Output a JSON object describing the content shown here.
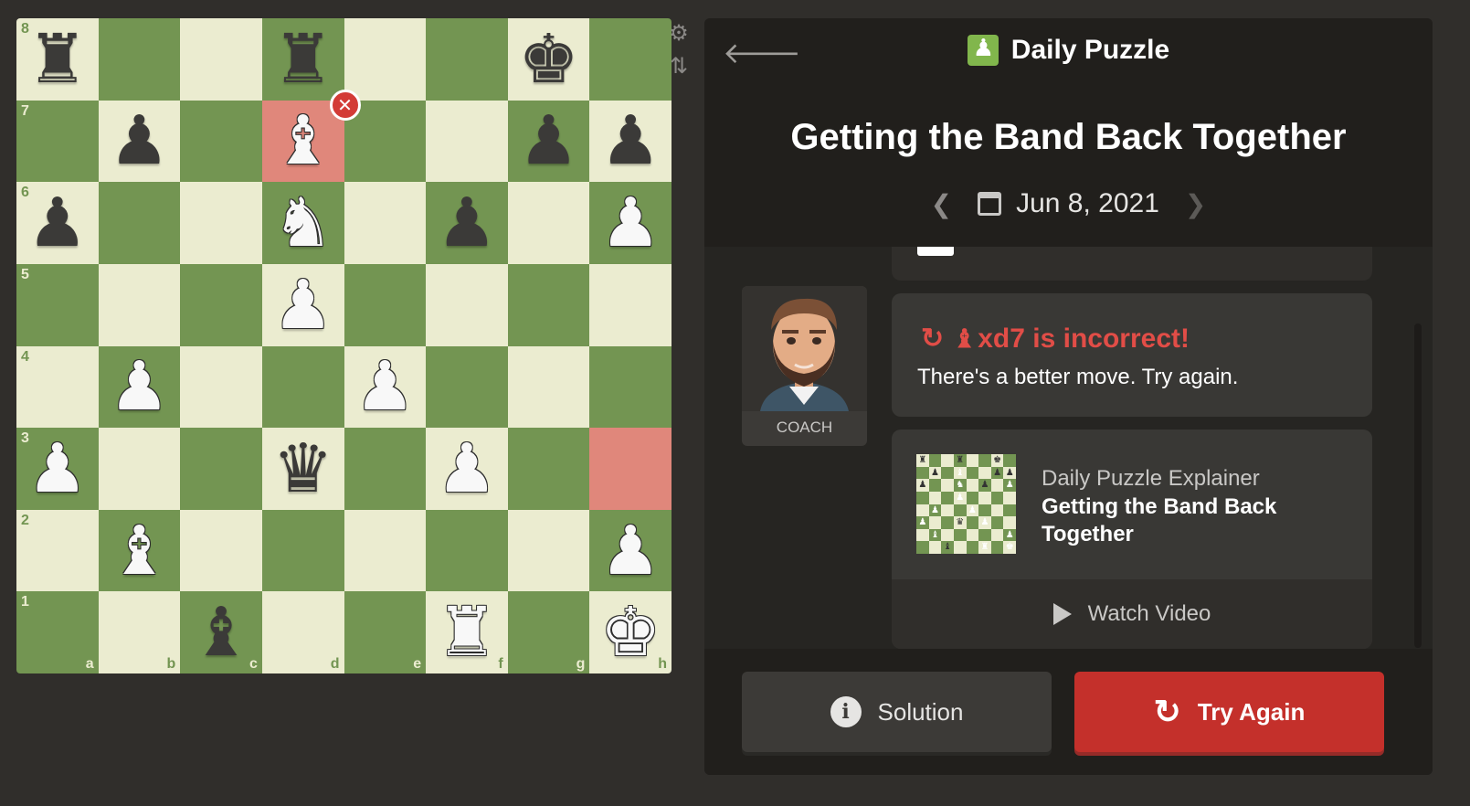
{
  "board": {
    "highlight_squares": [
      "d7",
      "h3"
    ],
    "error_square": "d7",
    "pieces": [
      {
        "sq": "a8",
        "color": "b",
        "type": "rook"
      },
      {
        "sq": "d8",
        "color": "b",
        "type": "rook"
      },
      {
        "sq": "g8",
        "color": "b",
        "type": "king"
      },
      {
        "sq": "b7",
        "color": "b",
        "type": "pawn"
      },
      {
        "sq": "d7",
        "color": "w",
        "type": "bishop"
      },
      {
        "sq": "g7",
        "color": "b",
        "type": "pawn"
      },
      {
        "sq": "h7",
        "color": "b",
        "type": "pawn"
      },
      {
        "sq": "a6",
        "color": "b",
        "type": "pawn"
      },
      {
        "sq": "d6",
        "color": "w",
        "type": "knight"
      },
      {
        "sq": "f6",
        "color": "b",
        "type": "pawn"
      },
      {
        "sq": "h6",
        "color": "w",
        "type": "pawn"
      },
      {
        "sq": "d5",
        "color": "w",
        "type": "pawn"
      },
      {
        "sq": "b4",
        "color": "w",
        "type": "pawn"
      },
      {
        "sq": "e4",
        "color": "w",
        "type": "pawn"
      },
      {
        "sq": "a3",
        "color": "w",
        "type": "pawn"
      },
      {
        "sq": "d3",
        "color": "b",
        "type": "queen"
      },
      {
        "sq": "f3",
        "color": "w",
        "type": "pawn"
      },
      {
        "sq": "b2",
        "color": "w",
        "type": "bishop"
      },
      {
        "sq": "h2",
        "color": "w",
        "type": "pawn"
      },
      {
        "sq": "c1",
        "color": "b",
        "type": "bishop"
      },
      {
        "sq": "f1",
        "color": "w",
        "type": "rook"
      },
      {
        "sq": "h1",
        "color": "w",
        "type": "king"
      }
    ],
    "files": [
      "a",
      "b",
      "c",
      "d",
      "e",
      "f",
      "g",
      "h"
    ],
    "ranks": [
      "8",
      "7",
      "6",
      "5",
      "4",
      "3",
      "2",
      "1"
    ]
  },
  "side_controls": {
    "settings_icon": "gear-icon",
    "flip_icon": "flip-board-icon"
  },
  "header": {
    "back_icon": "back-arrow-icon",
    "brand": "Daily Puzzle",
    "title": "Getting the Band Back Together",
    "date": "Jun 8, 2021",
    "prev_icon": "chevron-left-icon",
    "next_icon": "chevron-right-icon"
  },
  "coach": {
    "label": "COACH"
  },
  "message": {
    "move": "xd7 is incorrect!",
    "body": "There's a better move. Try again.",
    "color": "#e14d47"
  },
  "video": {
    "subtitle": "Daily Puzzle Explainer",
    "title": "Getting the Band Back Together",
    "watch_label": "Watch Video"
  },
  "footer": {
    "solution_label": "Solution",
    "retry_label": "Try Again",
    "retry_color": "#c4302b"
  }
}
